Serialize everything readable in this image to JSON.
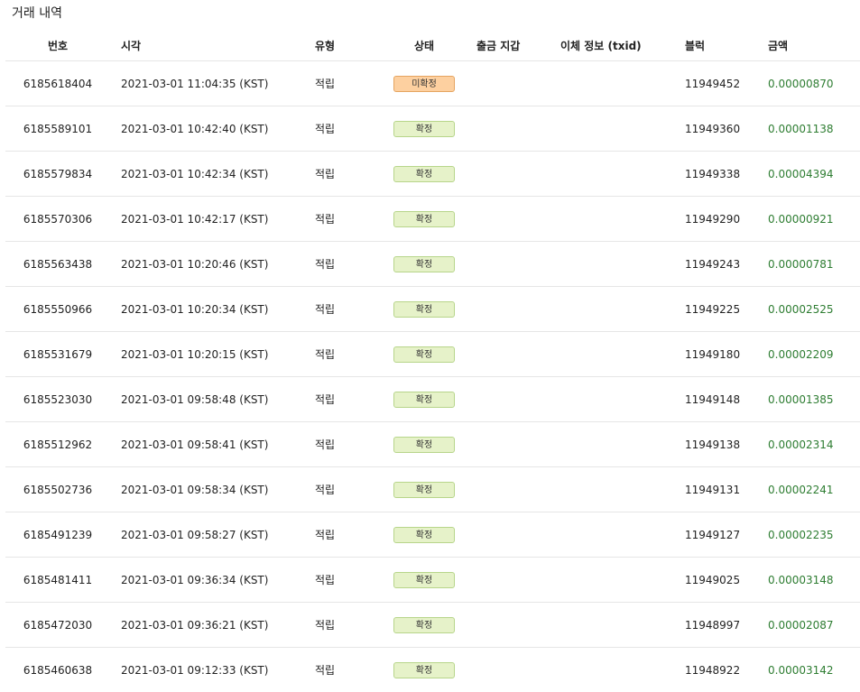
{
  "title": "거래 내역",
  "columns": {
    "number": "번호",
    "time": "시각",
    "type": "유형",
    "status": "상태",
    "delay": "출금 지갑",
    "txid": "이체 정보 (txid)",
    "block": "블럭",
    "amount": "금액"
  },
  "rows": [
    {
      "number": "6185618404",
      "time": "2021-03-01 11:04:35 (KST)",
      "type": "적립",
      "status": "미확정",
      "status_kind": "pending",
      "block": "11949452",
      "amount": "0.00000870"
    },
    {
      "number": "6185589101",
      "time": "2021-03-01 10:42:40 (KST)",
      "type": "적립",
      "status": "확정",
      "status_kind": "confirmed",
      "block": "11949360",
      "amount": "0.00001138"
    },
    {
      "number": "6185579834",
      "time": "2021-03-01 10:42:34 (KST)",
      "type": "적립",
      "status": "확정",
      "status_kind": "confirmed",
      "block": "11949338",
      "amount": "0.00004394"
    },
    {
      "number": "6185570306",
      "time": "2021-03-01 10:42:17 (KST)",
      "type": "적립",
      "status": "확정",
      "status_kind": "confirmed",
      "block": "11949290",
      "amount": "0.00000921"
    },
    {
      "number": "6185563438",
      "time": "2021-03-01 10:20:46 (KST)",
      "type": "적립",
      "status": "확정",
      "status_kind": "confirmed",
      "block": "11949243",
      "amount": "0.00000781"
    },
    {
      "number": "6185550966",
      "time": "2021-03-01 10:20:34 (KST)",
      "type": "적립",
      "status": "확정",
      "status_kind": "confirmed",
      "block": "11949225",
      "amount": "0.00002525"
    },
    {
      "number": "6185531679",
      "time": "2021-03-01 10:20:15 (KST)",
      "type": "적립",
      "status": "확정",
      "status_kind": "confirmed",
      "block": "11949180",
      "amount": "0.00002209"
    },
    {
      "number": "6185523030",
      "time": "2021-03-01 09:58:48 (KST)",
      "type": "적립",
      "status": "확정",
      "status_kind": "confirmed",
      "block": "11949148",
      "amount": "0.00001385"
    },
    {
      "number": "6185512962",
      "time": "2021-03-01 09:58:41 (KST)",
      "type": "적립",
      "status": "확정",
      "status_kind": "confirmed",
      "block": "11949138",
      "amount": "0.00002314"
    },
    {
      "number": "6185502736",
      "time": "2021-03-01 09:58:34 (KST)",
      "type": "적립",
      "status": "확정",
      "status_kind": "confirmed",
      "block": "11949131",
      "amount": "0.00002241"
    },
    {
      "number": "6185491239",
      "time": "2021-03-01 09:58:27 (KST)",
      "type": "적립",
      "status": "확정",
      "status_kind": "confirmed",
      "block": "11949127",
      "amount": "0.00002235"
    },
    {
      "number": "6185481411",
      "time": "2021-03-01 09:36:34 (KST)",
      "type": "적립",
      "status": "확정",
      "status_kind": "confirmed",
      "block": "11949025",
      "amount": "0.00003148"
    },
    {
      "number": "6185472030",
      "time": "2021-03-01 09:36:21 (KST)",
      "type": "적립",
      "status": "확정",
      "status_kind": "confirmed",
      "block": "11948997",
      "amount": "0.00002087"
    },
    {
      "number": "6185460638",
      "time": "2021-03-01 09:12:33 (KST)",
      "type": "적립",
      "status": "확정",
      "status_kind": "confirmed",
      "block": "11948922",
      "amount": "0.00003142"
    }
  ],
  "colors": {
    "amount": "#2e7d32",
    "badge_confirmed_bg": "#e6f2c9",
    "badge_pending_bg": "#fdd0a0",
    "row_divider": "#e6e6e6"
  }
}
